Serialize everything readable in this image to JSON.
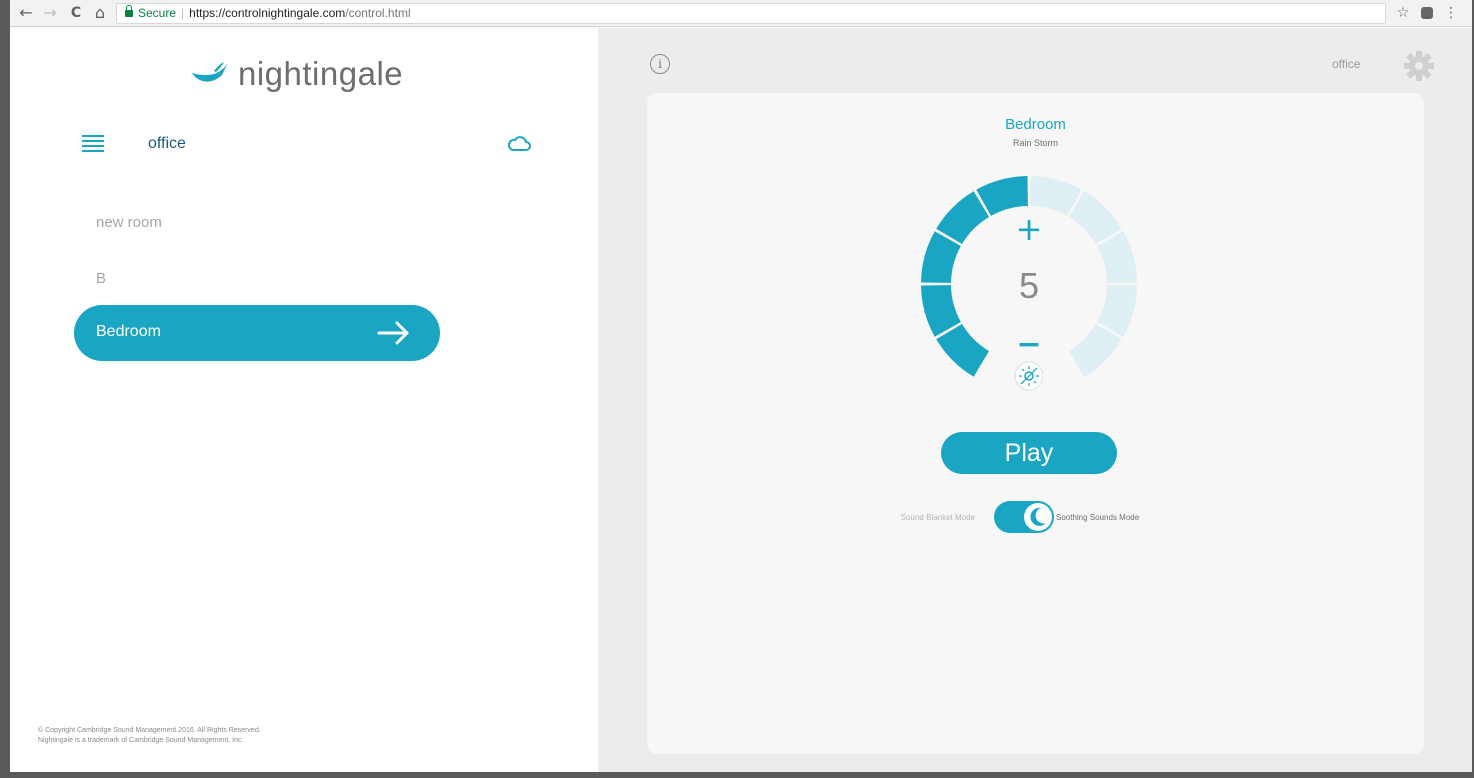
{
  "browser": {
    "back_glyph": "←",
    "forward_glyph": "→",
    "reload_glyph": "C",
    "home_glyph": "⌂",
    "secure_label": "Secure",
    "url_host": "https://controlnightingale.com",
    "url_path": "/control.html",
    "star_glyph": "☆",
    "menu_glyph": "⋮"
  },
  "sidebar": {
    "logo_text": "nightingale",
    "location": "office",
    "rooms": [
      {
        "label": "new room"
      },
      {
        "label": "B"
      }
    ],
    "active_room": "Bedroom",
    "copyright_line1": "© Copyright Cambridge Sound Management 2016. All Rights Reserved.",
    "copyright_line2": "Nightingale is a trademark of Cambridge Sound Management, Inc."
  },
  "header": {
    "info_glyph": "i",
    "location": "office"
  },
  "player": {
    "room": "Bedroom",
    "sound": "Rain Storm",
    "volume": "5",
    "volume_max": 10,
    "plus_glyph": "+",
    "minus_glyph": "−",
    "play_label": "Play",
    "mode_off_label": "Sound Blanket Mode",
    "mode_on_label": "Soothing Sounds Mode",
    "mode_on": true
  },
  "colors": {
    "accent": "#1aa6c3",
    "accent_light": "#dff0f4",
    "panel_bg": "#ececec",
    "card_bg": "#f7f7f7"
  },
  "icons": {
    "menu": "hamburger-icon",
    "cloud": "cloud-icon",
    "arrow": "arrow-right-icon",
    "settings": "gear-icon",
    "info": "info-icon",
    "light": "nightlight-icon",
    "moon": "moon-icon"
  }
}
